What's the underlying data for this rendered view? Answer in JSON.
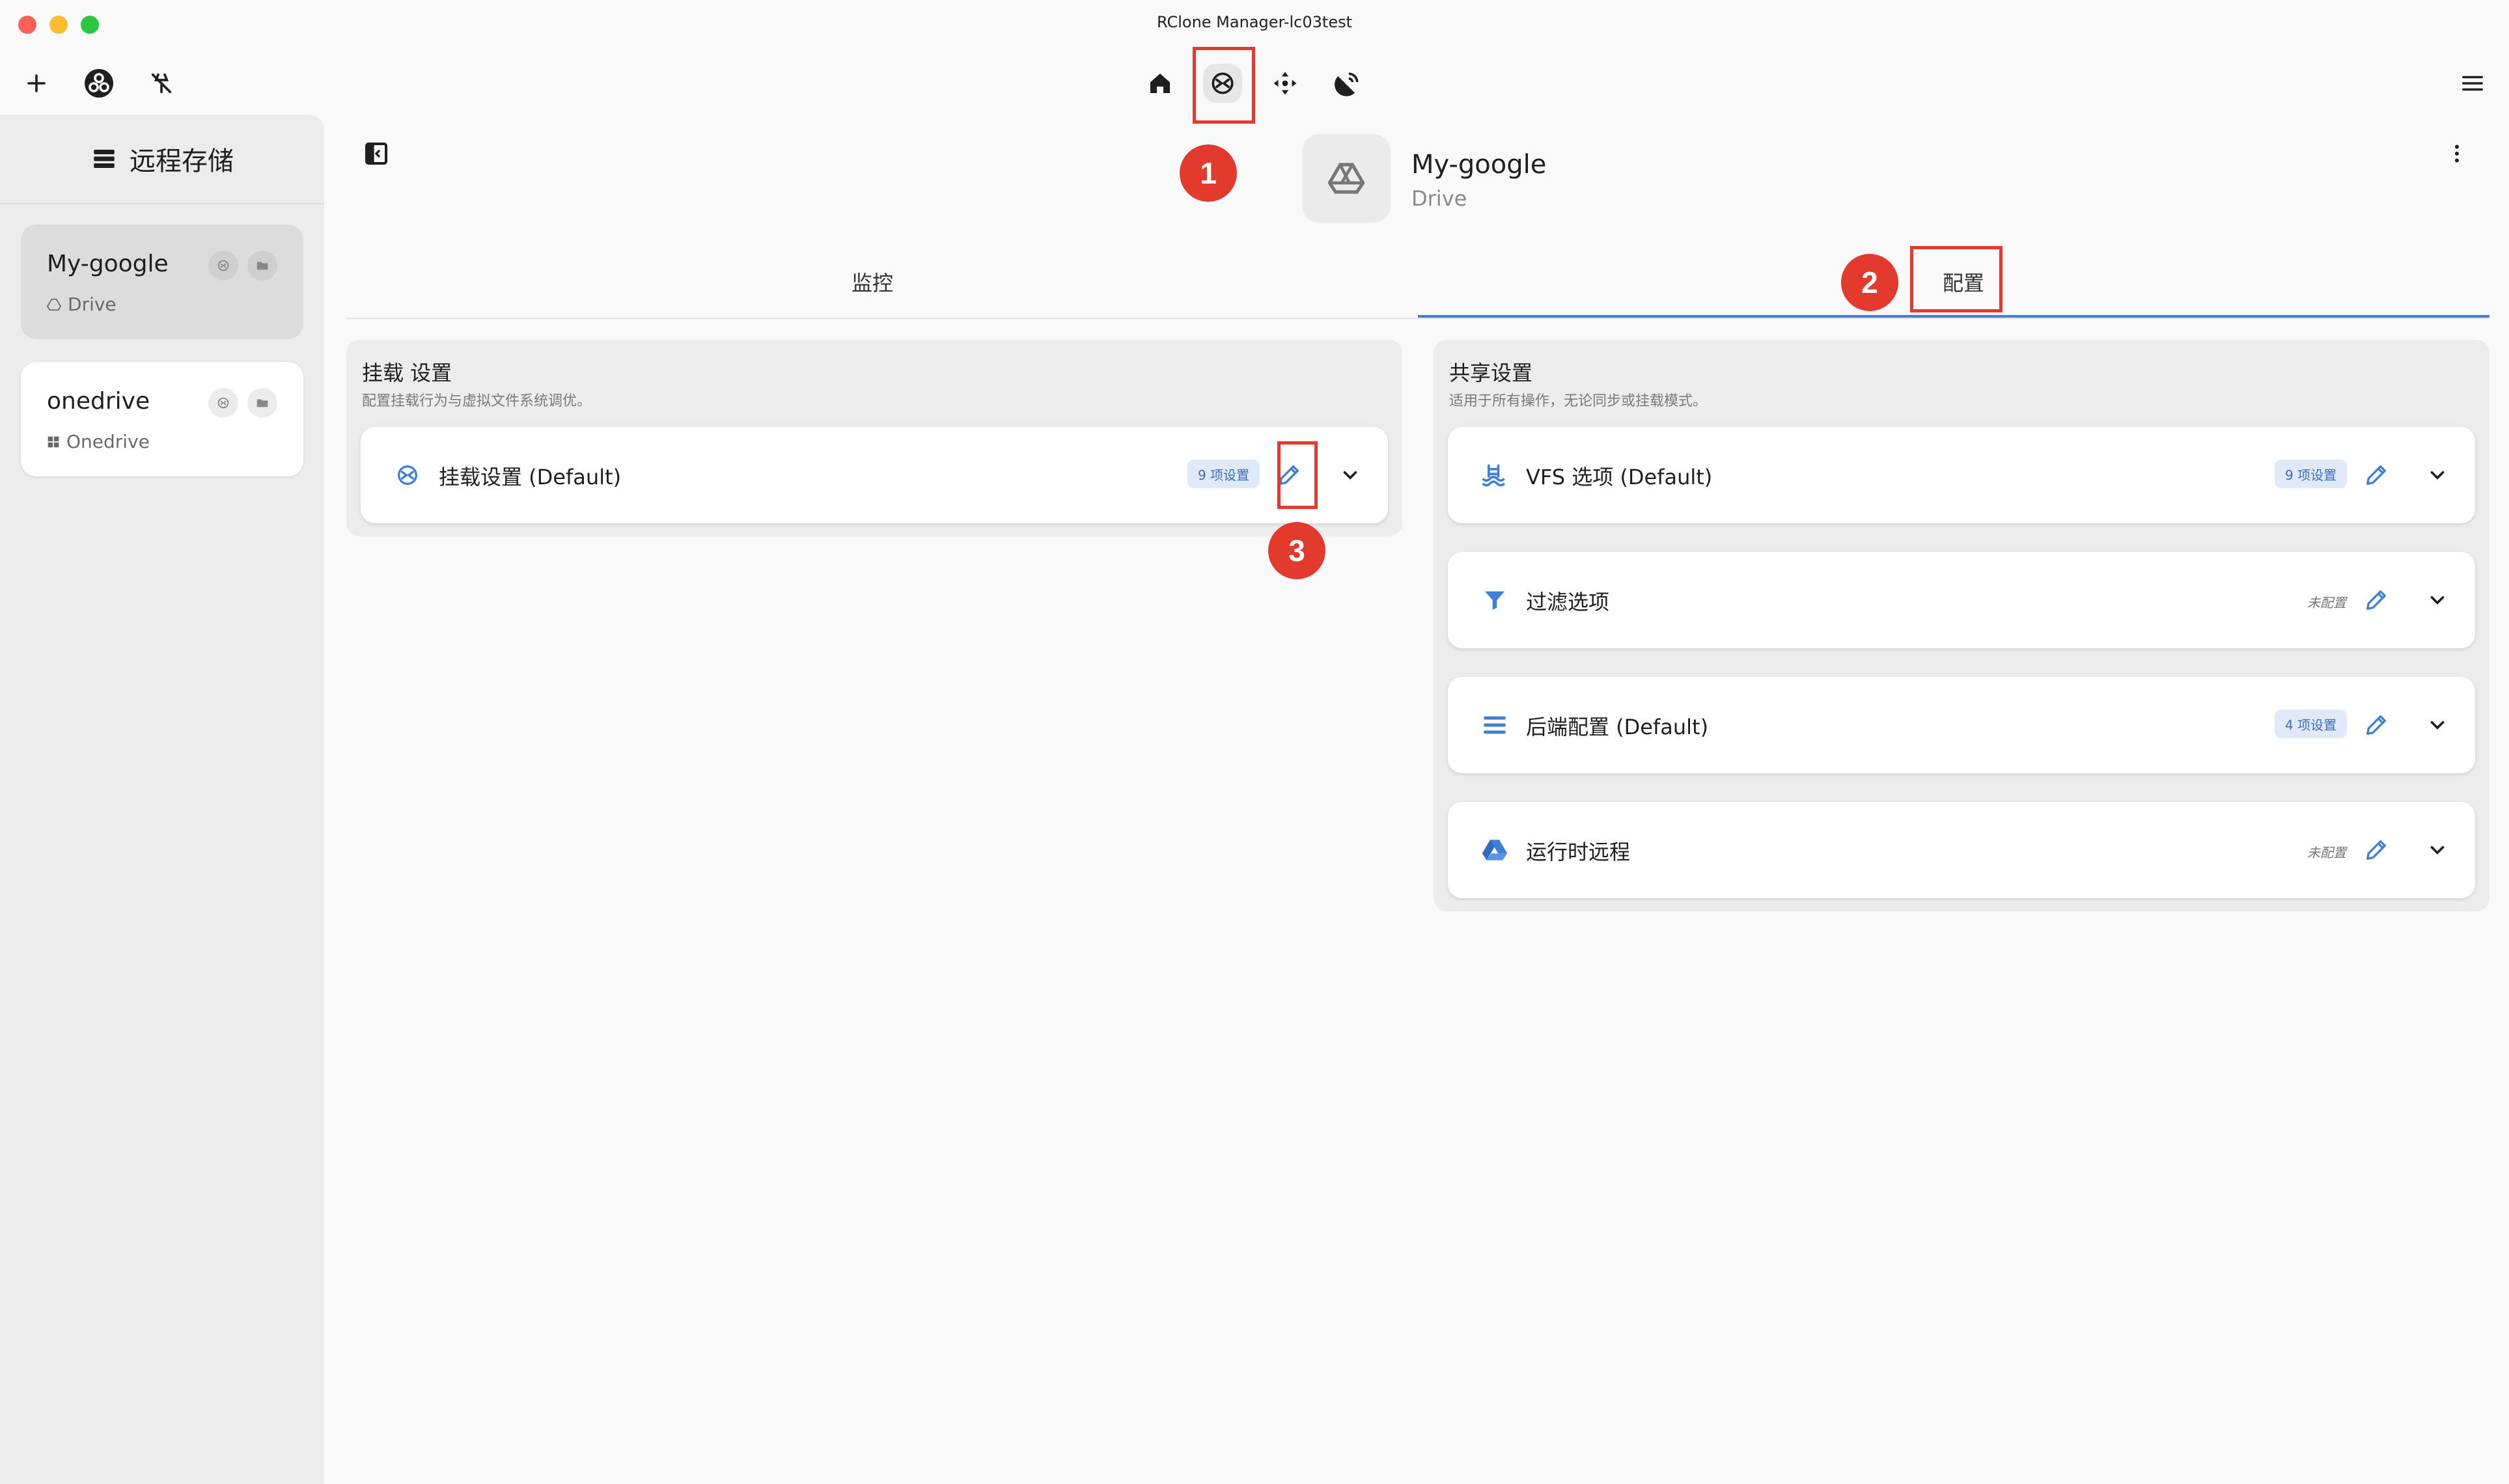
{
  "window": {
    "title": "RClone Manager-lc03test"
  },
  "sidebar": {
    "title": "远程存储",
    "remotes": [
      {
        "name": "My-google",
        "type": "Drive"
      },
      {
        "name": "onedrive",
        "type": "Onedrive"
      }
    ]
  },
  "header": {
    "remote_name": "My-google",
    "remote_type": "Drive"
  },
  "tabs": [
    {
      "label": "监控"
    },
    {
      "label": "配置"
    }
  ],
  "mount_panel": {
    "title": "挂载 设置",
    "subtitle": "配置挂载行为与虚拟文件系统调优。",
    "rows": [
      {
        "label": "挂载设置 (Default)",
        "badge": "9 项设置"
      }
    ]
  },
  "shared_panel": {
    "title": "共享设置",
    "subtitle": "适用于所有操作，无论同步或挂载模式。",
    "rows": [
      {
        "label": "VFS 选项 (Default)",
        "badge": "9 项设置"
      },
      {
        "label": "过滤选项",
        "status": "未配置"
      },
      {
        "label": "后端配置 (Default)",
        "badge": "4 项设置"
      },
      {
        "label": "运行时远程",
        "status": "未配置"
      }
    ]
  },
  "annotations": [
    "1",
    "2",
    "3"
  ],
  "colors": {
    "accent": "#3f7fd6",
    "annotation": "#e23b2e"
  }
}
